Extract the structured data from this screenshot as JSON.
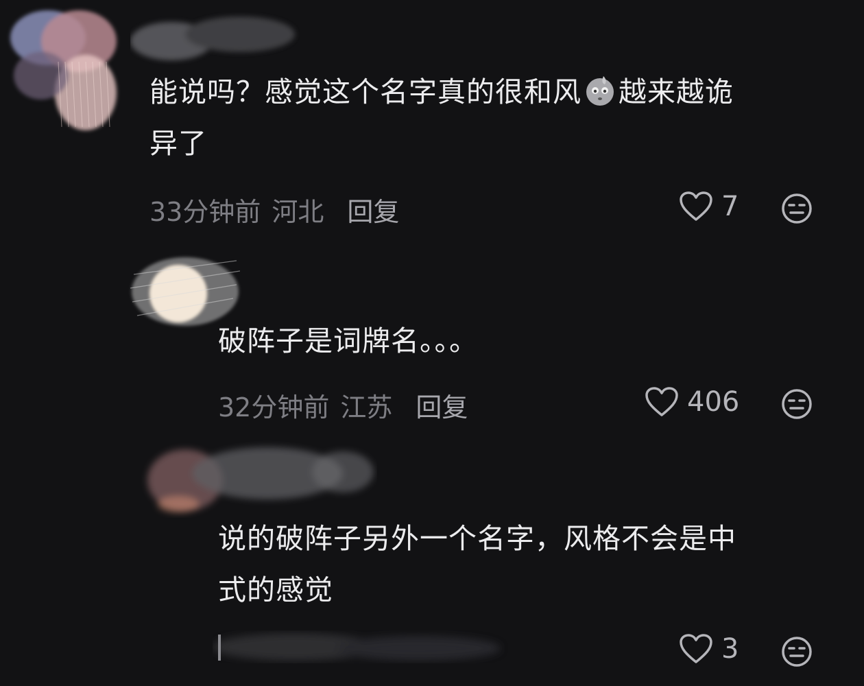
{
  "comments": [
    {
      "text_line1": "能说吗？感觉这个名字真的很和风",
      "text_line1b": "越来越诡",
      "text_line2": "异了",
      "emoji": "sweat-face-emoji",
      "time": "33分钟前",
      "location": "河北",
      "reply_label": "回复",
      "likes": "7"
    },
    {
      "text_line1": "破阵子是词牌名。。。",
      "time": "32分钟前",
      "location": "江苏",
      "reply_label": "回复",
      "likes": "406"
    },
    {
      "text_line1": "说的破阵子另外一个名字，风格不会是中",
      "text_line2": "式的感觉",
      "likes": "3"
    }
  ],
  "icons": {
    "like": "heart-icon",
    "dislike": "dislike-face-icon"
  },
  "colors": {
    "background": "#121214",
    "text": "#ececee",
    "meta": "#7e7e84"
  }
}
